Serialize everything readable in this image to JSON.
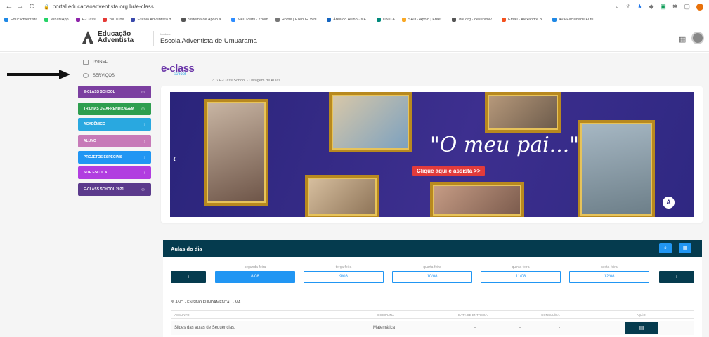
{
  "browser": {
    "back": "←",
    "forward": "→",
    "reload": "C",
    "url": "portal.educacaoadventista.org.br/e-class",
    "bookmarks": [
      {
        "label": "EducAdventista",
        "color": "#1e88e5"
      },
      {
        "label": "WhatsApp",
        "color": "#25d366"
      },
      {
        "label": "E-Class",
        "color": "#8e24aa"
      },
      {
        "label": "YouTube",
        "color": "#e53935"
      },
      {
        "label": "Escola Adventista d...",
        "color": "#3949ab"
      },
      {
        "label": "Sistema de Apoio a...",
        "color": "#555555"
      },
      {
        "label": "Meu Perfil · Zoom",
        "color": "#2d8cff"
      },
      {
        "label": "Home | Ellen G. Whi...",
        "color": "#777777"
      },
      {
        "label": "Área do Aluno · NE...",
        "color": "#1565c0"
      },
      {
        "label": "UNICA",
        "color": "#00897b"
      },
      {
        "label": "SAD · Apoio | Freet...",
        "color": "#f9a825"
      },
      {
        "label": "Jtaí.org · desenvolv...",
        "color": "#555555"
      },
      {
        "label": "Email · Alexandre B...",
        "color": "#f4511e"
      },
      {
        "label": "AVA Faculdade Futu...",
        "color": "#1e88e5"
      }
    ]
  },
  "header": {
    "logo_line1": "Educação",
    "logo_line2": "Adventista",
    "school_small": "Unidade",
    "school_name": "Escola Adventista de Umuarama"
  },
  "sidebar": {
    "links": [
      {
        "label": "PAINEL"
      },
      {
        "label": "SERVIÇOS"
      }
    ],
    "menu": [
      {
        "label": "E-CLASS SCHOOL",
        "color": "#7b3fa0",
        "icon": "☺"
      },
      {
        "label": "TRILHAS DE APRENDIZAGEM",
        "color": "#2e9e4f",
        "icon": "☺"
      },
      {
        "label": "ACADÊMICO",
        "color": "#29a8e0",
        "icon": "›"
      },
      {
        "label": "ALUNO",
        "color": "#c77ab8",
        "icon": "›"
      },
      {
        "label": "PROJETOS ESPECIAIS",
        "color": "#2196f3",
        "icon": "›"
      },
      {
        "label": "SITE ESCOLA",
        "color": "#b13de0",
        "icon": "›"
      },
      {
        "label": "E-CLASS SCHOOL 2021",
        "color": "#5b3a8c",
        "icon": "☺"
      }
    ]
  },
  "breadcrumb": {
    "logo_main": "e-class",
    "logo_sub": "school",
    "home_icon": "⌂",
    "text": "› E-Class School › Listagem de Aulas"
  },
  "banner": {
    "title": "\"O meu pai...\"",
    "cta": "Clique aqui e assista >>",
    "prev": "‹",
    "badge": "A"
  },
  "lessons": {
    "title": "Aulas do dia",
    "search_icon": "⌕",
    "calendar_icon": "▦",
    "prev_label": "‹",
    "next_label": "›",
    "days": [
      {
        "weekday": "segunda-feira",
        "date": "8/08",
        "active": true
      },
      {
        "weekday": "terça-feira",
        "date": "9/08",
        "active": false
      },
      {
        "weekday": "quarta-feira",
        "date": "10/08",
        "active": false
      },
      {
        "weekday": "quinta-feira",
        "date": "11/08",
        "active": false
      },
      {
        "weekday": "sexta-feira",
        "date": "12/08",
        "active": false
      }
    ],
    "class_title": "8º ANO - ENSINO FUNDAMENTAL - MA",
    "columns": [
      "ASSUNTO",
      "DISCIPLINA",
      "DATA DE ENTREGA",
      "CONCLUÍDA",
      "AÇÃO"
    ],
    "rows": [
      {
        "subject": "Slides das aulas de Sequências.",
        "discipline": "Matemática",
        "due": "-",
        "x": "-",
        "done": "-",
        "action_icon": "▤"
      }
    ]
  }
}
